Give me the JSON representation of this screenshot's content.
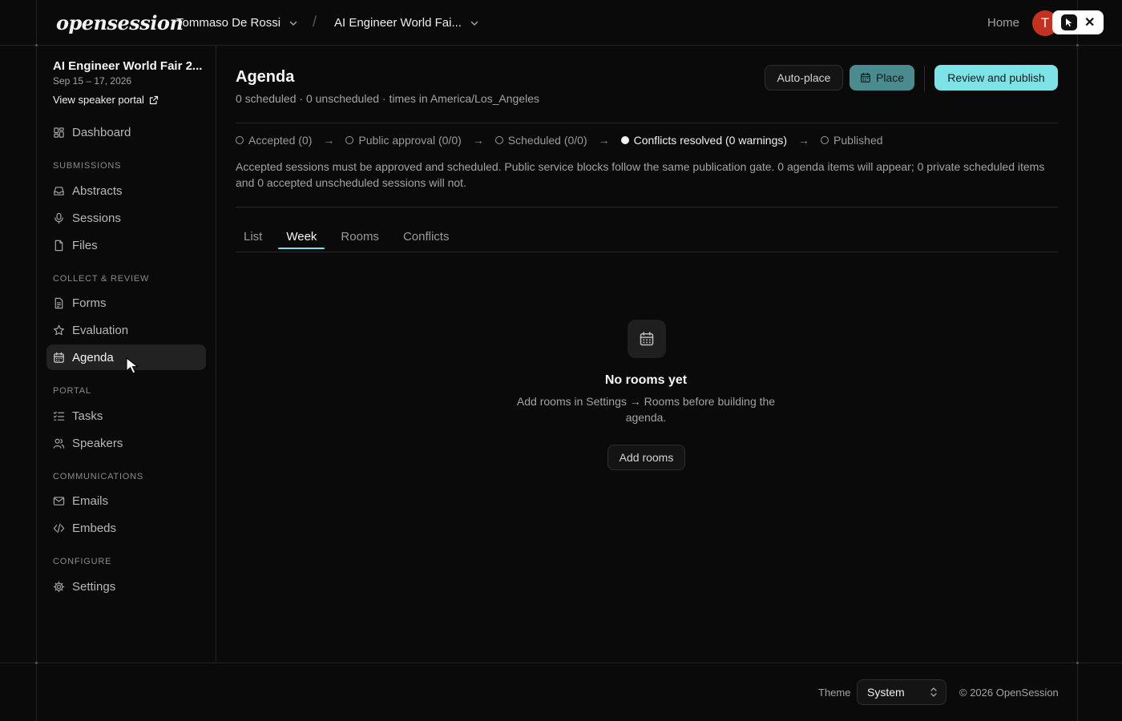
{
  "header": {
    "logo": "opensession",
    "org": "Tommaso De Rossi",
    "separator": "/",
    "event": "AI Engineer World Fai...",
    "home": "Home",
    "avatar_initial": "T"
  },
  "sidebar": {
    "event_title": "AI Engineer World Fair 2...",
    "event_dates": "Sep 15 – 17, 2026",
    "portal_link": "View speaker portal",
    "dashboard": "Dashboard",
    "sections": {
      "submissions": "SUBMISSIONS",
      "collect_review": "COLLECT & REVIEW",
      "portal": "PORTAL",
      "communications": "COMMUNICATIONS",
      "configure": "CONFIGURE"
    },
    "items": {
      "abstracts": "Abstracts",
      "sessions": "Sessions",
      "files": "Files",
      "forms": "Forms",
      "evaluation": "Evaluation",
      "agenda": "Agenda",
      "tasks": "Tasks",
      "speakers": "Speakers",
      "emails": "Emails",
      "embeds": "Embeds",
      "settings": "Settings"
    },
    "active_item": "agenda"
  },
  "main": {
    "title": "Agenda",
    "subtitle": "0 scheduled · 0 unscheduled · times in America/Los_Angeles",
    "buttons": {
      "auto_place": "Auto-place",
      "place": "Place",
      "review_publish": "Review and publish"
    },
    "steps": [
      {
        "label": "Accepted (0)",
        "done": false
      },
      {
        "label": "Public approval (0/0)",
        "done": false
      },
      {
        "label": "Scheduled (0/0)",
        "done": false
      },
      {
        "label": "Conflicts resolved (0 warnings)",
        "done": true
      },
      {
        "label": "Published",
        "done": false
      }
    ],
    "step_arrow": "→",
    "notice": "Accepted sessions must be approved and scheduled. Public service blocks follow the same publication gate. 0 agenda items will appear; 0 private scheduled items and 0 accepted unscheduled sessions will not.",
    "tabs": [
      "List",
      "Week",
      "Rooms",
      "Conflicts"
    ],
    "active_tab": "Week",
    "empty_state": {
      "icon": "calendar-icon",
      "title": "No rooms yet",
      "description": "Add rooms in Settings → Rooms before building the agenda.",
      "button": "Add rooms"
    }
  },
  "footer": {
    "theme_label": "Theme",
    "theme_value": "System",
    "copyright": "© 2026 OpenSession"
  },
  "colors": {
    "background": "#0a0a0a",
    "accent": "#7de3e6",
    "place_button": "#4a8b8f",
    "avatar": "#c4321f"
  }
}
